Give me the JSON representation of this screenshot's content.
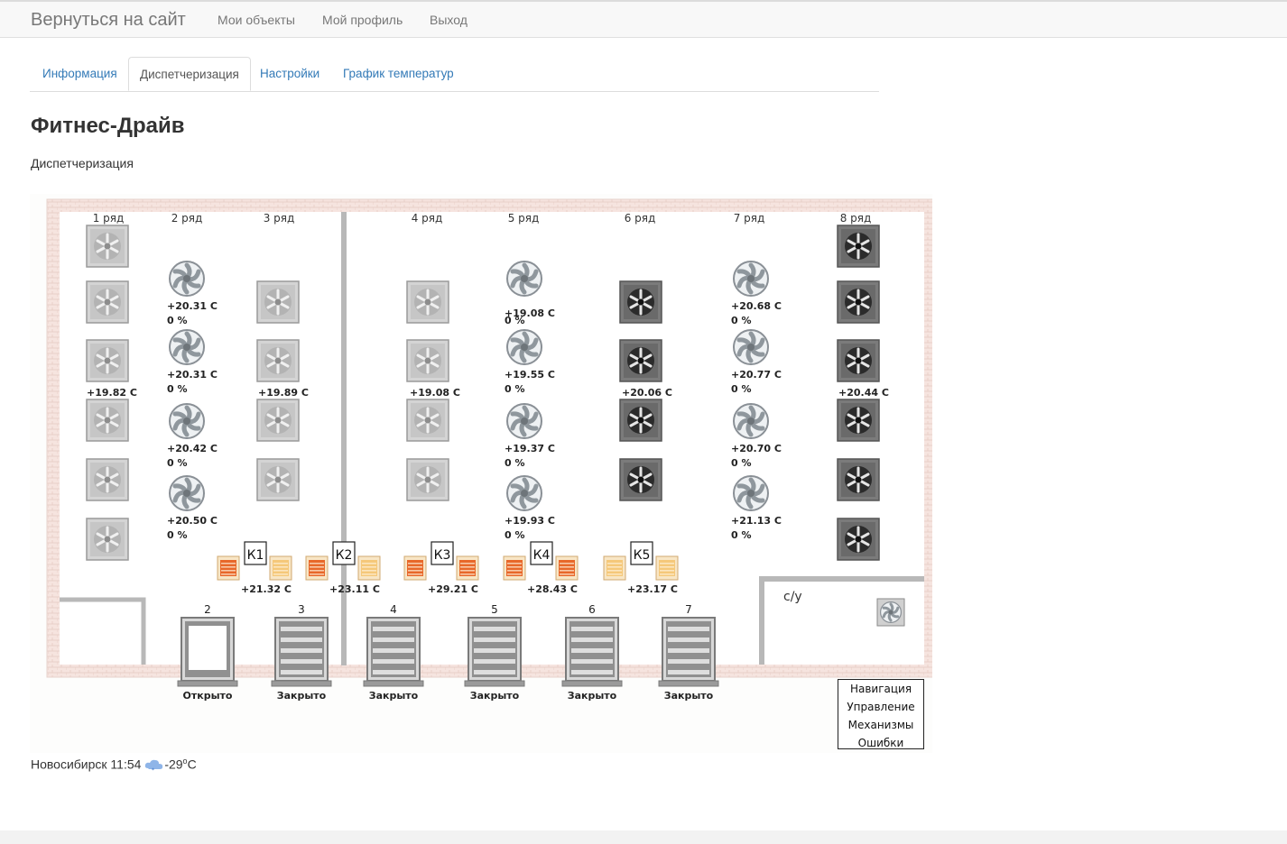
{
  "navbar": {
    "brand": "Вернуться на сайт",
    "links": [
      "Мои объекты",
      "Мой профиль",
      "Выход"
    ]
  },
  "tabs": [
    {
      "label": "Информация",
      "active": false
    },
    {
      "label": "Диспетчеризация",
      "active": true
    },
    {
      "label": "Настройки",
      "active": false
    },
    {
      "label": "График температур",
      "active": false
    }
  ],
  "page": {
    "title": "Фитнес-Драйв",
    "subtitle": "Диспетчеризация"
  },
  "scheme": {
    "rows": [
      "1 ряд",
      "2 ряд",
      "3 ряд",
      "4 ряд",
      "5 ряд",
      "6 ряд",
      "7 ряд",
      "8 ряд"
    ],
    "heater_temps": [
      {
        "text": "+19.82 С",
        "icon": "light-heater-icon"
      },
      {
        "text": "+19.89 С",
        "icon": "light-heater-icon"
      },
      {
        "text": "+19.08 С",
        "icon": "light-heater-icon"
      },
      {
        "text": "+20.06 С",
        "icon": "dark-heater-icon"
      },
      {
        "text": "+20.44 С",
        "icon": "dark-heater-icon"
      }
    ],
    "fans": [
      {
        "temp": "+20.31 С",
        "pct": "0 %"
      },
      {
        "temp": "+20.31 С",
        "pct": "0 %"
      },
      {
        "temp": "+20.42 С",
        "pct": "0 %"
      },
      {
        "temp": "+20.50 С",
        "pct": "0 %"
      },
      {
        "temp": "+19.08 С",
        "pct": "0 %"
      },
      {
        "temp": "+19.55 С",
        "pct": "0 %"
      },
      {
        "temp": "+19.37 С",
        "pct": "0 %"
      },
      {
        "temp": "+19.93 С",
        "pct": "0 %"
      },
      {
        "temp": "+20.68 С",
        "pct": "0 %"
      },
      {
        "temp": "+20.77 С",
        "pct": "0 %"
      },
      {
        "temp": "+20.70 С",
        "pct": "0 %"
      },
      {
        "temp": "+21.13 С",
        "pct": "0 %"
      }
    ],
    "curtains": [
      {
        "label": "К1",
        "temp": "+21.32 С"
      },
      {
        "label": "К2",
        "temp": "+23.11 С"
      },
      {
        "label": "К3",
        "temp": "+29.21 С"
      },
      {
        "label": "К4",
        "temp": "+28.43 С"
      },
      {
        "label": "К5",
        "temp": "+23.17 С"
      }
    ],
    "gates": [
      {
        "number": "2",
        "state": "Открыто"
      },
      {
        "number": "3",
        "state": "Закрыто"
      },
      {
        "number": "4",
        "state": "Закрыто"
      },
      {
        "number": "5",
        "state": "Закрыто"
      },
      {
        "number": "6",
        "state": "Закрыто"
      },
      {
        "number": "7",
        "state": "Закрыто"
      }
    ],
    "room_label": "с/у",
    "colors": {
      "wall": "#f6e4df",
      "heater_light": "#bdbdbd",
      "heater_dark": "#5a5a5a",
      "curtain_active": "#e8682a",
      "curtain_idle": "#f5c87a"
    }
  },
  "side_menu": [
    "Навигация",
    "Управление",
    "Механизмы",
    "Ошибки"
  ],
  "weather": {
    "city_time": "Новосибирск 11:54",
    "icon": "cloud-snow-icon",
    "temp": "-29",
    "unit": "°C"
  }
}
